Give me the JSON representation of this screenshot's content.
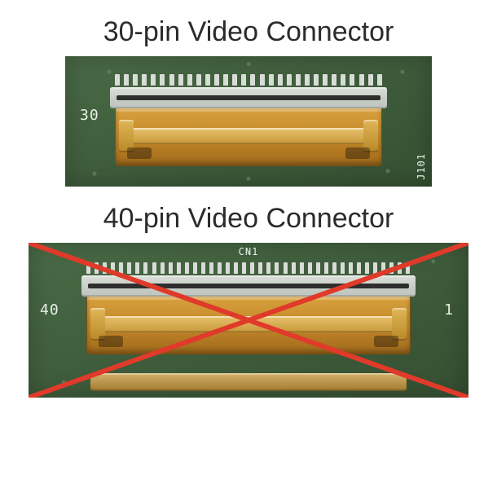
{
  "sections": {
    "top": {
      "title": "30-pin Video Connector",
      "pins": 30,
      "crossed_out": false,
      "silkscreen": {
        "left_num": "30",
        "right_num": "",
        "right_small": "J101"
      }
    },
    "bottom": {
      "title": "40-pin Video Connector",
      "pins": 40,
      "crossed_out": true,
      "silkscreen": {
        "left_num": "40",
        "right_num": "1",
        "top_small": "CN1"
      }
    }
  },
  "colors": {
    "cross": "#e03a2a",
    "pcb": "#3e5c3b",
    "silk": "#e8efe8",
    "connector_metal": "#c6ccc5",
    "connector_brass": "#c08528"
  }
}
